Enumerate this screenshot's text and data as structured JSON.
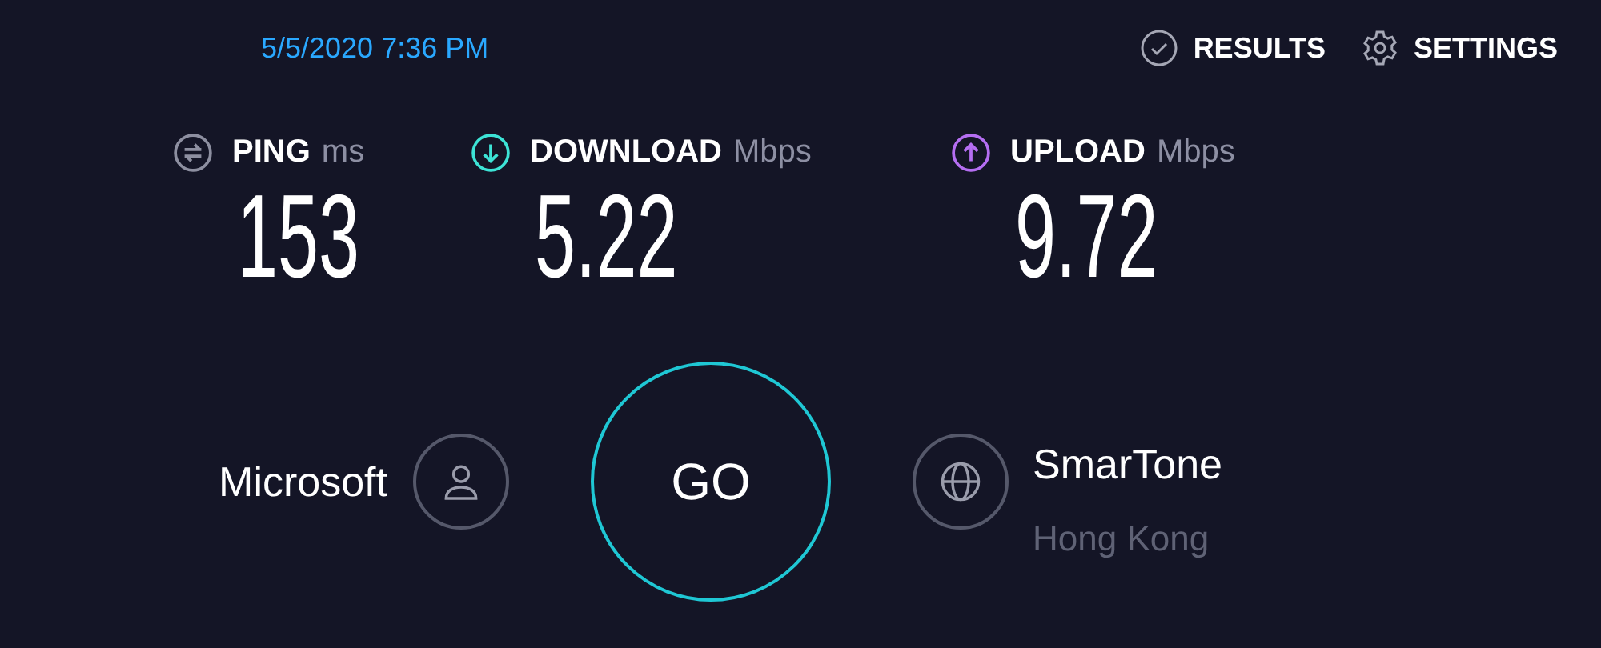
{
  "date": "5/5/2020 7:36 PM",
  "nav": [
    {
      "kind": "results",
      "label": "RESULTS"
    },
    {
      "kind": "settings",
      "label": "SETTINGS"
    }
  ],
  "metrics": [
    {
      "kind": "ping",
      "label": "PING",
      "unit": "ms",
      "value": "153"
    },
    {
      "kind": "download",
      "label": "DOWNLOAD",
      "unit": "Mbps",
      "value": "5.22"
    },
    {
      "kind": "upload",
      "label": "UPLOAD",
      "unit": "Mbps",
      "value": "9.72"
    }
  ],
  "server": {
    "name": "Microsoft"
  },
  "go_button": "GO",
  "isp": {
    "name": "SmarTone",
    "location": "Hong Kong"
  }
}
